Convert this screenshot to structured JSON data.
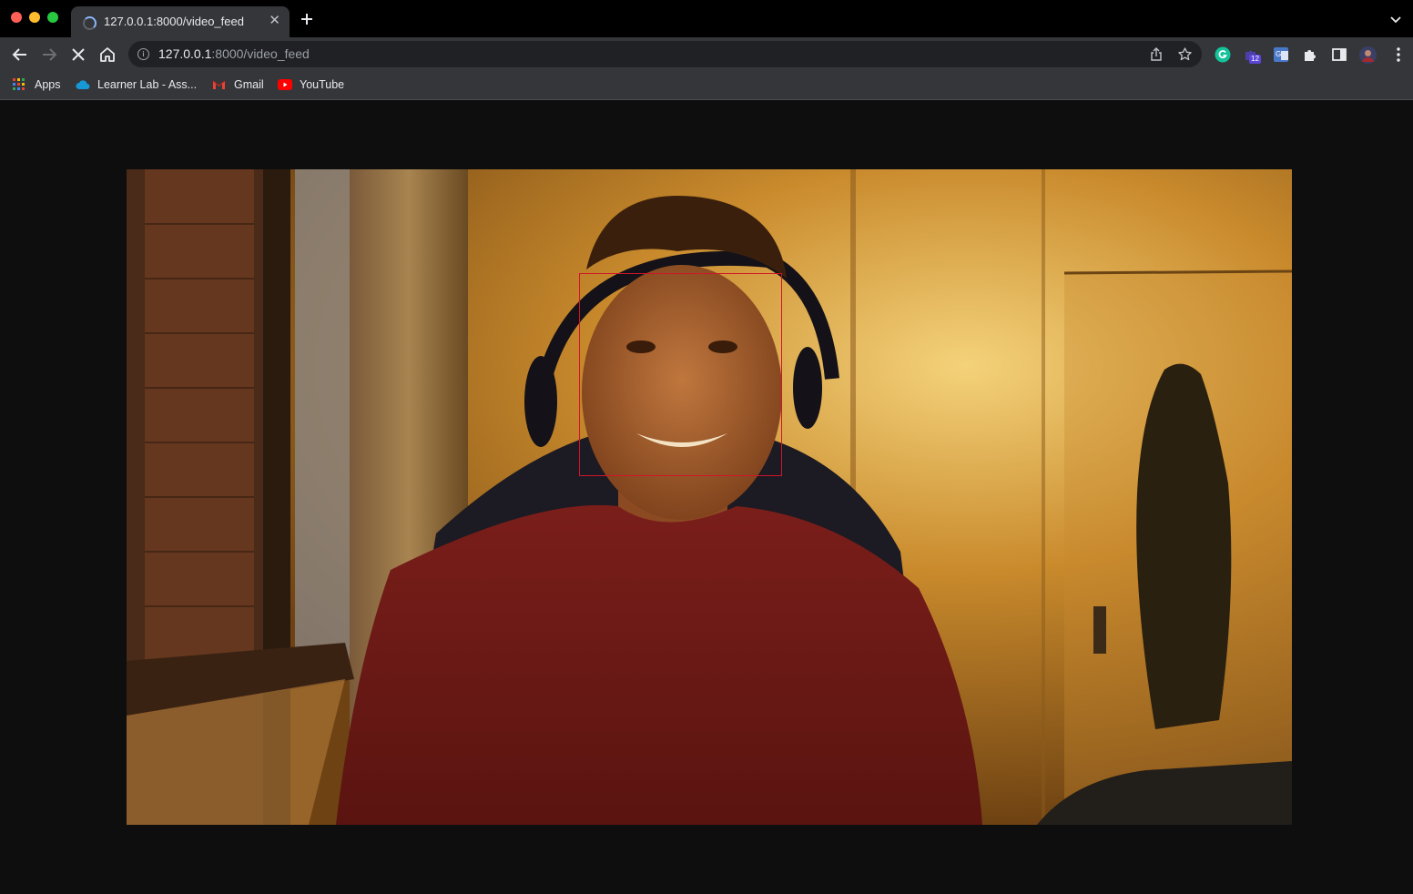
{
  "tab": {
    "title": "127.0.0.1:8000/video_feed",
    "close_glyph": "✕"
  },
  "toolbar": {
    "url_host": "127.0.0.1",
    "url_rest": ":8000/video_feed",
    "extension_badge": "12"
  },
  "bookmarks": [
    {
      "label": "Apps",
      "icon": "apps-grid-icon"
    },
    {
      "label": "Learner Lab - Ass...",
      "icon": "cloud-icon"
    },
    {
      "label": "Gmail",
      "icon": "gmail-icon"
    },
    {
      "label": "YouTube",
      "icon": "youtube-icon"
    }
  ],
  "video": {
    "detection_box_color": "#d0152a",
    "background": "#0e0e0e"
  }
}
